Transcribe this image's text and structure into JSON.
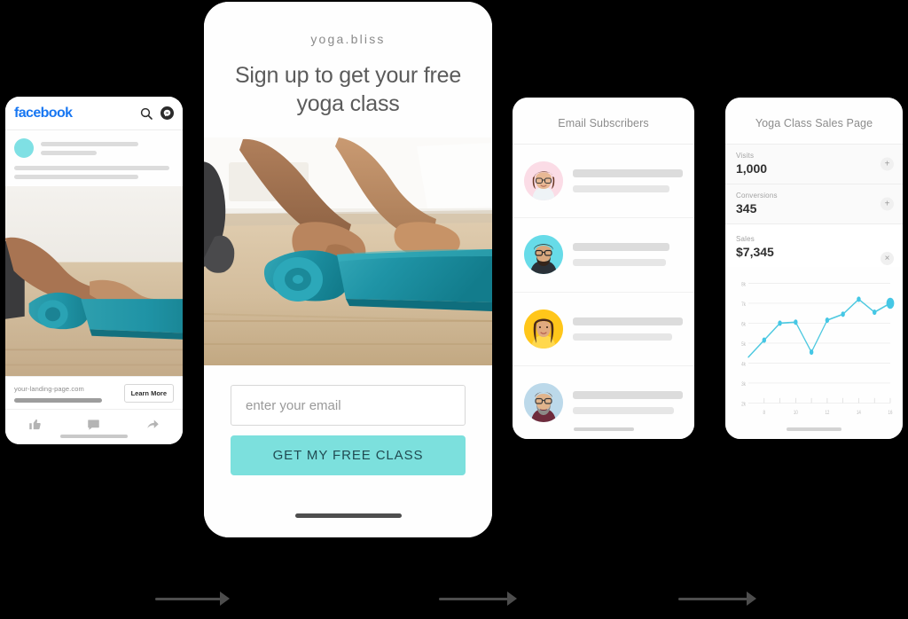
{
  "background_color": "#000000",
  "accent_color": "#7ce0dd",
  "facebook_ad": {
    "logo_text": "facebook",
    "logo_color": "#1877f2",
    "icons": [
      "search-icon",
      "messenger-icon"
    ],
    "link_url": "your-landing-page.com",
    "cta_label": "Learn More",
    "actions": [
      "like-icon",
      "comment-icon",
      "share-icon"
    ]
  },
  "landing_page": {
    "brand": "yoga.bliss",
    "headline": "Sign up to get your free yoga class",
    "email_placeholder": "enter your email",
    "email_value": "",
    "cta_label": "GET MY FREE CLASS"
  },
  "subscribers": {
    "title": "Email Subscribers",
    "rows": [
      {
        "avatar_bg": "#fbdce6",
        "avatar": "woman-glasses-avatar"
      },
      {
        "avatar_bg": "#67dbe8",
        "avatar": "bearded-man-glasses-avatar"
      },
      {
        "avatar_bg": "#ffc61a",
        "avatar": "woman-yellow-avatar"
      },
      {
        "avatar_bg": "#bcd9ea",
        "avatar": "man-beard-glasses-avatar"
      }
    ]
  },
  "analytics": {
    "title": "Yoga Class Sales Page",
    "stats": [
      {
        "label": "Visits",
        "value": "1,000",
        "action": "+"
      },
      {
        "label": "Conversions",
        "value": "345",
        "action": "+"
      },
      {
        "label": "Sales",
        "value": "$7,345",
        "action": "×"
      }
    ]
  },
  "chart_data": {
    "type": "line",
    "title": "",
    "xlabel": "",
    "ylabel": "",
    "x": [
      7,
      8,
      9,
      10,
      11,
      12,
      13,
      14,
      15,
      16
    ],
    "values": [
      4300,
      5150,
      6000,
      6050,
      4550,
      6150,
      6450,
      7200,
      6550,
      7000
    ],
    "xlim": [
      7,
      16
    ],
    "ylim": [
      2000,
      8000
    ],
    "x_ticks": [
      8,
      9,
      10,
      11,
      12,
      13,
      14,
      15,
      16
    ],
    "x_tick_labels": [
      "8",
      "",
      "10",
      "",
      "12",
      "",
      "14",
      "",
      "16"
    ],
    "y_ticks": [
      2000,
      3000,
      4000,
      5000,
      6000,
      7000,
      8000
    ],
    "y_tick_labels": [
      "2k",
      "3k",
      "4k",
      "5k",
      "6k",
      "7k",
      "8k"
    ],
    "line_color": "#4ec9e0",
    "point_color": "#45c7e5",
    "highlight_index": 9,
    "grid": true,
    "legend": "none"
  },
  "connectors": [
    {
      "name": "connector-ad-to-landing"
    },
    {
      "name": "connector-landing-to-subscribers"
    },
    {
      "name": "connector-subscribers-to-analytics"
    }
  ]
}
